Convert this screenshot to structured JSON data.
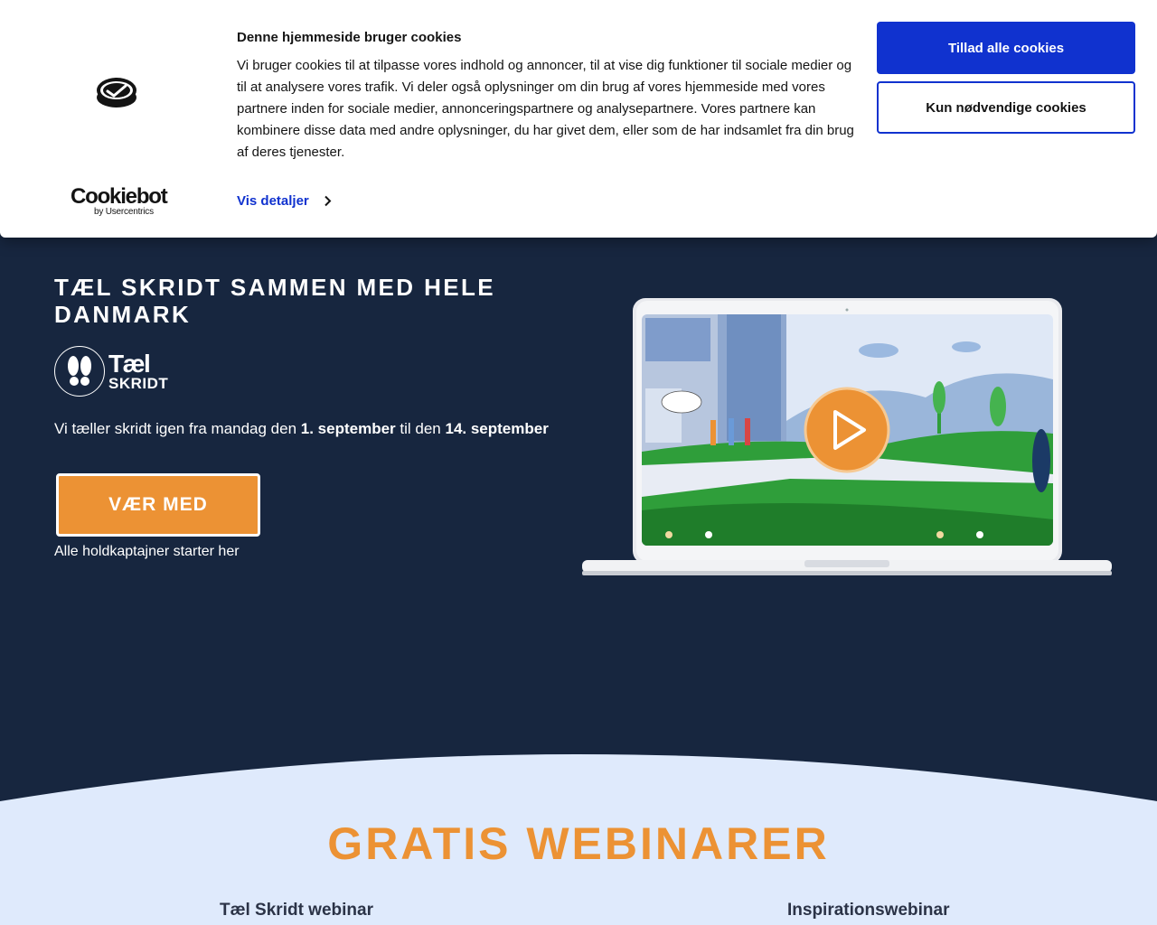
{
  "cookie_banner": {
    "brand": "Cookiebot",
    "brand_sub": "by Usercentrics",
    "title": "Denne hjemmeside bruger cookies",
    "text": "Vi bruger cookies til at tilpasse vores indhold og annoncer, til at vise dig funktioner til sociale medier og til at analysere vores trafik. Vi deler også oplysninger om din brug af vores hjemmeside med vores partnere inden for sociale medier, annonceringspartnere og analysepartnere. Vores partnere kan kombinere disse data med andre oplysninger, du har givet dem, eller som de har indsamlet fra din brug af deres tjenester.",
    "details_link": "Vis detaljer",
    "allow_all_label": "Tillad alle cookies",
    "necessary_only_label": "Kun nødvendige cookies",
    "accent_color": "#1032cf"
  },
  "hero": {
    "title": "TÆL SKRIDT SAMMEN MED HELE DANMARK",
    "logo_line1": "Tæl",
    "logo_line2": "SKRIDT",
    "dates_prefix": "Vi tæller skridt igen fra mandag den ",
    "date_start": "1. september",
    "dates_middle": " til den ",
    "date_end": "14. september",
    "cta_label": "VÆR MED",
    "cta_note": "Alle holdkaptajner starter her",
    "cta_color": "#ec9234",
    "background": "#17263f"
  },
  "video": {
    "play_icon": "play-icon"
  },
  "webinars": {
    "title": "GRATIS WEBINARER",
    "items": [
      {
        "label": "Tæl Skridt webinar"
      },
      {
        "label": "Inspirationswebinar"
      }
    ],
    "background": "#dfeafc"
  }
}
